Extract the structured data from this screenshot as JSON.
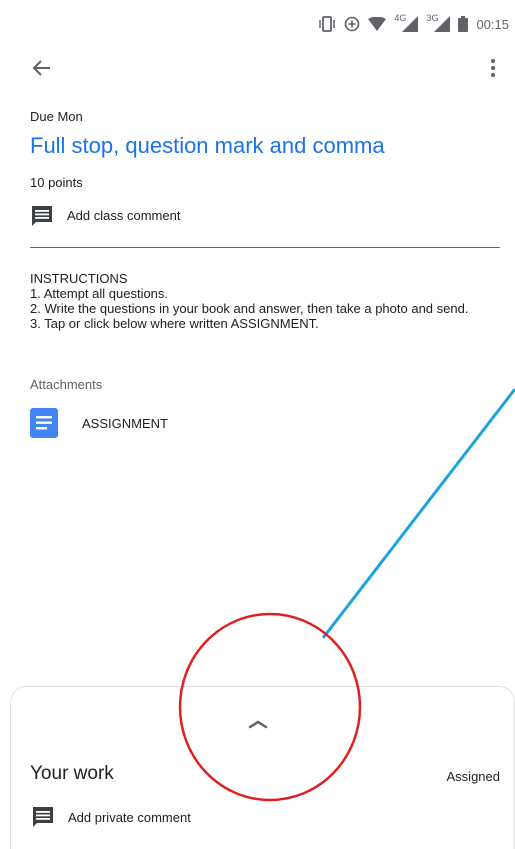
{
  "status_bar": {
    "network_4g": "4G",
    "network_3g": "3G",
    "time": "00:15",
    "icons": [
      "vibrate-icon",
      "data-saver-icon",
      "wifi-icon",
      "signal-4g-icon",
      "signal-3g-icon",
      "battery-icon"
    ]
  },
  "app_bar": {
    "back_icon": "arrow-back-icon",
    "menu_icon": "more-vert-icon"
  },
  "assignment": {
    "due": "Due Mon",
    "title": "Full stop, question mark and comma",
    "points": "10 points",
    "class_comment_label": "Add class comment",
    "instructions": [
      "INSTRUCTIONS",
      "1. Attempt all questions.",
      "2. Write the questions in your book and answer, then take a photo and send.",
      "3. Tap or click below where written ASSIGNMENT."
    ],
    "attachments_label": "Attachments",
    "attachment_name": "ASSIGNMENT"
  },
  "bottom_sheet": {
    "heading": "Your work",
    "status": "Assigned",
    "private_comment_label": "Add private comment"
  },
  "colors": {
    "accent": "#1a73e8",
    "annotation_line": "#1ca3dc",
    "annotation_circle": "#e02020",
    "doc_icon": "#4285f4"
  }
}
